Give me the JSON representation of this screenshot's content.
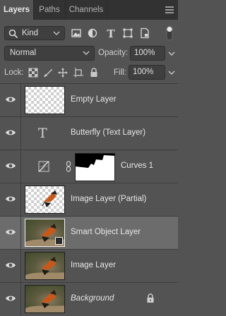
{
  "tabs": [
    {
      "label": "Layers",
      "active": true
    },
    {
      "label": "Paths",
      "active": false
    },
    {
      "label": "Channels",
      "active": false
    }
  ],
  "filter": {
    "kind_label": "Kind",
    "filter_icons": [
      "image-filter-icon",
      "adjustment-filter-icon",
      "type-filter-icon",
      "shape-filter-icon",
      "smart-object-filter-icon"
    ]
  },
  "blend": {
    "mode": "Normal",
    "opacity_label": "Opacity:",
    "opacity_value": "100%"
  },
  "lock": {
    "label": "Lock:",
    "fill_label": "Fill:",
    "fill_value": "100%"
  },
  "layers": [
    {
      "name": "Empty Layer",
      "kind": "pixel-empty",
      "visible": true,
      "selected": false
    },
    {
      "name": "Butterfly (Text Layer)",
      "kind": "text",
      "visible": true,
      "selected": false
    },
    {
      "name": "Curves 1",
      "kind": "adjustment",
      "visible": true,
      "selected": false
    },
    {
      "name": "Image Layer (Partial)",
      "kind": "pixel-partial",
      "visible": true,
      "selected": false
    },
    {
      "name": "Smart Object Layer",
      "kind": "smart-object",
      "visible": true,
      "selected": true
    },
    {
      "name": "Image Layer",
      "kind": "pixel",
      "visible": true,
      "selected": false
    },
    {
      "name": "Background",
      "kind": "background",
      "visible": true,
      "selected": false,
      "locked": true
    }
  ],
  "colors": {
    "panel_bg": "#535353",
    "tabbar_bg": "#323232",
    "selected_row": "#6c6c6c"
  }
}
